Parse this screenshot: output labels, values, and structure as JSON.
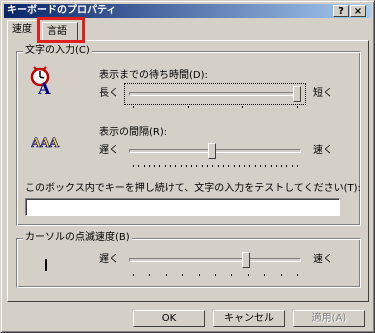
{
  "window": {
    "title": "キーボードのプロパティ",
    "help_label": "?",
    "close_label": "×"
  },
  "tabs": [
    {
      "label": "速度",
      "active": true
    },
    {
      "label": "言語",
      "active": false
    }
  ],
  "char_input": {
    "title": "文字の入力(C)",
    "repeat_delay": {
      "label": "表示までの待ち時間(D):",
      "min_label": "長く",
      "max_label": "短く",
      "value_fraction": 1.0,
      "tick_count": 4
    },
    "repeat_rate": {
      "label": "表示の間隔(R):",
      "min_label": "遅く",
      "max_label": "速く",
      "value_fraction": 0.48,
      "tick_count": 32
    },
    "test_label": "このボックス内でキーを押し続けて、文字の入力をテストしてください(T):",
    "test_value": ""
  },
  "cursor_blink": {
    "title": "カーソルの点滅速度(B)",
    "min_label": "遅く",
    "max_label": "速く",
    "value_fraction": 0.69,
    "tick_count": 11
  },
  "buttons": {
    "ok": "OK",
    "cancel": "キャンセル",
    "apply": "適用(A)"
  },
  "colors": {
    "highlight": "#e0201a",
    "title_start": "#0a246a",
    "title_end": "#a6caf0"
  }
}
